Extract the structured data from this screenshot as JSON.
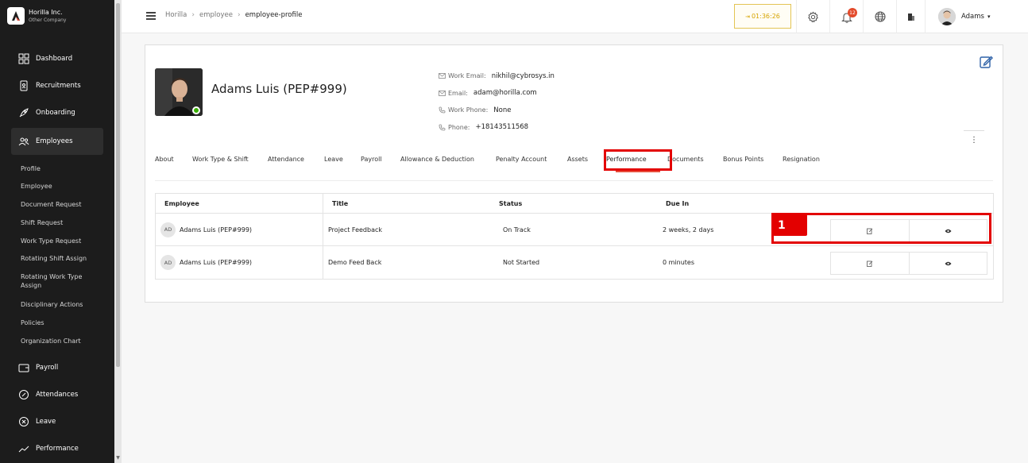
{
  "brand": {
    "name": "Horilla Inc.",
    "subtitle": "Other Company"
  },
  "sidebar": {
    "main_items": [
      {
        "label": "Dashboard",
        "icon": "dashboard-icon"
      },
      {
        "label": "Recruitments",
        "icon": "recruitment-icon"
      },
      {
        "label": "Onboarding",
        "icon": "rocket-icon"
      },
      {
        "label": "Employees",
        "icon": "people-icon",
        "active": true
      }
    ],
    "sub_items": [
      "Profile",
      "Employee",
      "Document Request",
      "Shift Request",
      "Work Type Request",
      "Rotating Shift Assign",
      "Rotating Work Type Assign",
      "Disciplinary Actions",
      "Policies",
      "Organization Chart"
    ],
    "bottom_items": [
      {
        "label": "Payroll",
        "icon": "wallet-icon"
      },
      {
        "label": "Attendances",
        "icon": "clock-icon"
      },
      {
        "label": "Leave",
        "icon": "leave-icon"
      },
      {
        "label": "Performance",
        "icon": "chart-line-icon"
      }
    ]
  },
  "topbar": {
    "breadcrumbs": [
      "Horilla",
      "employee",
      "employee-profile"
    ],
    "timer": "01:36:26",
    "notification_count": "12",
    "user_name": "Adams"
  },
  "profile": {
    "name": "Adams Luis (PEP#999)",
    "contacts": [
      {
        "label": "Work Email:",
        "value": "nikhil@cybrosys.in",
        "icon": "mail-icon"
      },
      {
        "label": "Email:",
        "value": "adam@horilla.com",
        "icon": "mail-icon"
      },
      {
        "label": "Work Phone:",
        "value": "None",
        "icon": "phone-icon"
      },
      {
        "label": "Phone:",
        "value": "+18143511568",
        "icon": "phone-icon"
      }
    ]
  },
  "tabs": [
    "About",
    "Work Type & Shift",
    "Attendance",
    "Leave",
    "Payroll",
    "Allowance & Deduction",
    "Penalty Account",
    "Assets",
    "Performance",
    "Documents",
    "Bonus Points",
    "Resignation"
  ],
  "active_tab": "Performance",
  "table": {
    "headers": [
      "Employee",
      "Title",
      "Status",
      "Due In"
    ],
    "rows": [
      {
        "initials": "AD",
        "employee": "Adams Luis (PEP#999)",
        "title": "Project Feedback",
        "status": "On Track",
        "due": "2 weeks, 2 days"
      },
      {
        "initials": "AD",
        "employee": "Adams Luis (PEP#999)",
        "title": "Demo Feed Back",
        "status": "Not Started",
        "due": "0 minutes"
      }
    ]
  },
  "annotation": {
    "label": "1"
  },
  "colors": {
    "accent": "#e84e3c",
    "highlight": "#e30000",
    "timer": "#d6a400",
    "online": "#38b000"
  }
}
